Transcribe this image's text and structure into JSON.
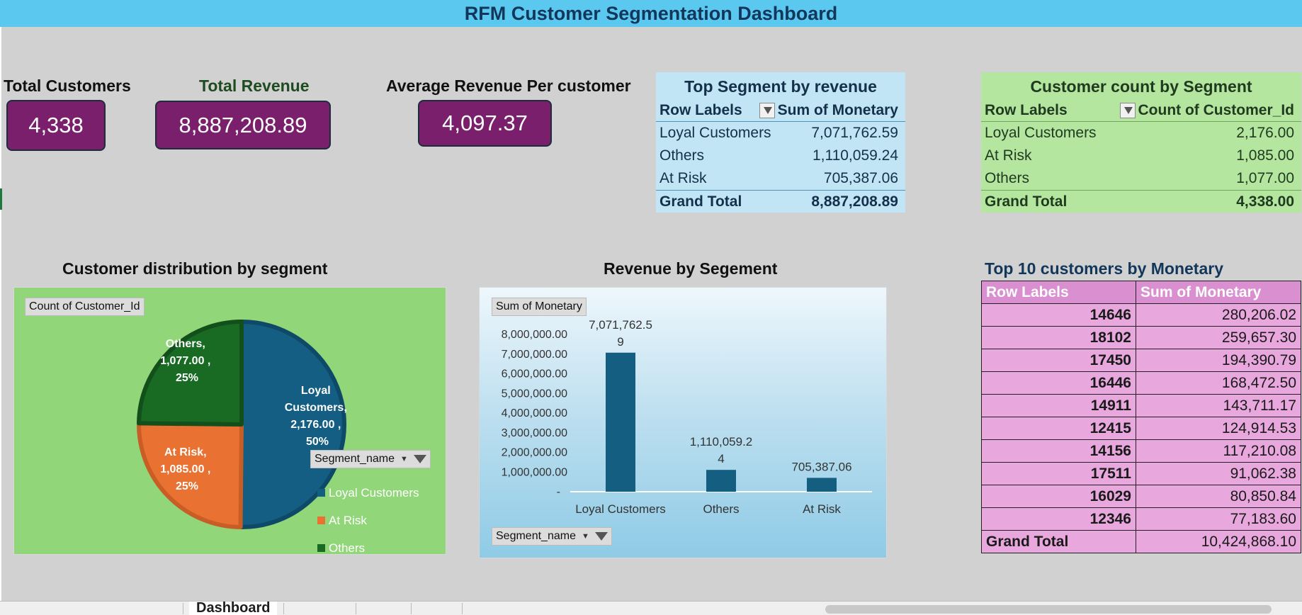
{
  "dashboard_title": "RFM Customer Segmentation Dashboard",
  "colors": {
    "title_bar": "#5bc8f0",
    "kpi_box": "#7a1f6b",
    "loyal": "#135e82",
    "at_risk": "#e97132",
    "others": "#196b24",
    "bar": "#145e82",
    "pie_bg": "#92d67a",
    "top10_bg": "#e8a8de"
  },
  "kpis": [
    {
      "label": "Total Customers",
      "value": "4,338"
    },
    {
      "label": "Total Revenue",
      "value": "8,887,208.89"
    },
    {
      "label": "Average Revenue Per customer",
      "value": "4,097.37"
    }
  ],
  "pivot_revenue": {
    "title": "Top Segment by revenue",
    "col1": "Row Labels",
    "col2": "Sum of Monetary",
    "rows": [
      {
        "label": "Loyal Customers",
        "value": "7,071,762.59"
      },
      {
        "label": "Others",
        "value": "1,110,059.24"
      },
      {
        "label": "At Risk",
        "value": "705,387.06"
      }
    ],
    "total_label": "Grand Total",
    "total_value": "8,887,208.89"
  },
  "pivot_count": {
    "title": "Customer count by Segment",
    "col1": "Row Labels",
    "col2": "Count of Customer_Id",
    "rows": [
      {
        "label": "Loyal Customers",
        "value": "2,176.00"
      },
      {
        "label": "At Risk",
        "value": "1,085.00"
      },
      {
        "label": "Others",
        "value": "1,077.00"
      }
    ],
    "total_label": "Grand Total",
    "total_value": "4,338.00"
  },
  "pie_section": {
    "title": "Customer distribution by segment",
    "field_button": "Count of Customer_Id",
    "filter_label": "Segment_name",
    "labels": {
      "others": [
        "Others,",
        "1,077.00 ,",
        "25%"
      ],
      "loyal": [
        "Loyal",
        "Customers,",
        "2,176.00 ,",
        "50%"
      ],
      "at_risk": [
        "At Risk,",
        "1,085.00 ,",
        "25%"
      ]
    },
    "legend": [
      "Loyal Customers",
      "At Risk",
      "Others"
    ]
  },
  "bar_section": {
    "title": "Revenue by Segement",
    "field_button": "Sum of Monetary",
    "filter_label": "Segment_name"
  },
  "top10": {
    "title": "Top 10 customers by Monetary",
    "col1": "Row Labels",
    "col2": "Sum of Monetary",
    "rows": [
      {
        "id": "14646",
        "value": "280,206.02"
      },
      {
        "id": "18102",
        "value": "259,657.30"
      },
      {
        "id": "17450",
        "value": "194,390.79"
      },
      {
        "id": "16446",
        "value": "168,472.50"
      },
      {
        "id": "14911",
        "value": "143,711.17"
      },
      {
        "id": "12415",
        "value": "124,914.53"
      },
      {
        "id": "14156",
        "value": "117,210.08"
      },
      {
        "id": "17511",
        "value": "91,062.38"
      },
      {
        "id": "16029",
        "value": "80,850.84"
      },
      {
        "id": "12346",
        "value": "77,183.60"
      }
    ],
    "total_label": "Grand Total",
    "total_value": "10,424,868.10"
  },
  "sheet_tabs": {
    "active": "Dashboard"
  },
  "chart_data": [
    {
      "type": "pie",
      "categories": [
        "Loyal Customers",
        "At Risk",
        "Others"
      ],
      "values": [
        2176,
        1085,
        1077
      ],
      "percentages": [
        50,
        25,
        25
      ],
      "legend": "right"
    },
    {
      "type": "bar",
      "categories": [
        "Loyal Customers",
        "Others",
        "At Risk"
      ],
      "values": [
        7071762.59,
        1110059.24,
        705387.06
      ],
      "data_labels": [
        "7,071,762.5\n9",
        "1,110,059.2\n4",
        "705,387.06"
      ],
      "ylim": [
        0,
        8000000
      ],
      "yticks": [
        "-",
        "1,000,000.00",
        "2,000,000.00",
        "3,000,000.00",
        "4,000,000.00",
        "5,000,000.00",
        "6,000,000.00",
        "7,000,000.00",
        "8,000,000.00"
      ],
      "grid": false
    }
  ]
}
